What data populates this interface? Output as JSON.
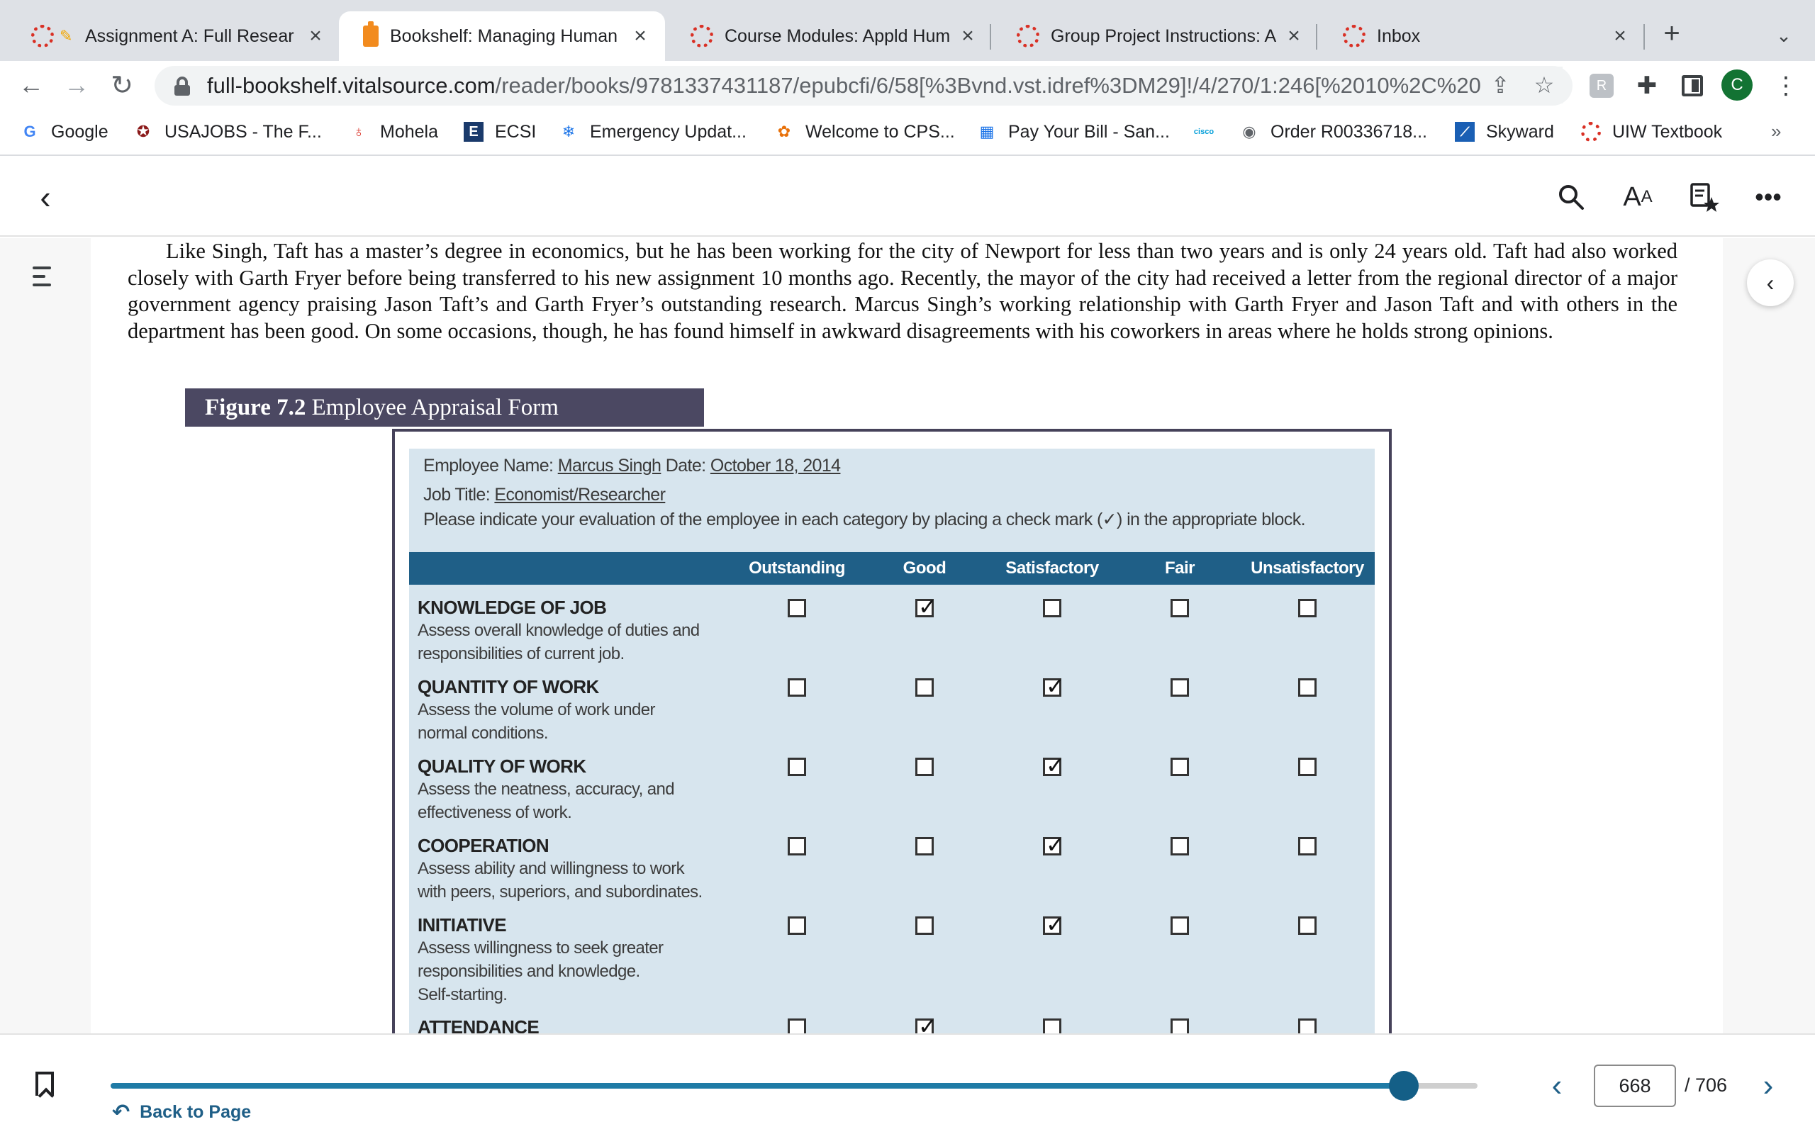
{
  "browser": {
    "tabs": [
      {
        "title": "Assignment A: Full Resear",
        "active": false
      },
      {
        "title": "Bookshelf: Managing Human",
        "active": true
      },
      {
        "title": "Course Modules: Appld Huma",
        "active": false
      },
      {
        "title": "Group Project Instructions: A",
        "active": false
      },
      {
        "title": "Inbox",
        "active": false
      }
    ],
    "url_host": "full-bookshelf.vitalsource.com",
    "url_path": "/reader/books/9781337431187/epubcfi/6/58[%3Bvnd.vst.idref%3DM29]!/4/270/1:246[%2010%2C%20...",
    "profile_initial": "C",
    "bookmarks": [
      {
        "label": "Google",
        "icon": "google-icon"
      },
      {
        "label": "USAJOBS - The F...",
        "icon": "usajobs-icon"
      },
      {
        "label": "Mohela",
        "icon": "apple-icon"
      },
      {
        "label": "ECSI",
        "icon": "ecsi-icon"
      },
      {
        "label": "Emergency Updat...",
        "icon": "snowflake-icon"
      },
      {
        "label": "Welcome to CPS...",
        "icon": "flower-icon"
      },
      {
        "label": "Pay Your Bill - San...",
        "icon": "bill-icon"
      },
      {
        "label": "",
        "icon": "cisco-icon"
      },
      {
        "label": "Order R00336718...",
        "icon": "order-icon"
      },
      {
        "label": "Skyward",
        "icon": "skyward-icon"
      },
      {
        "label": "UIW Textbook",
        "icon": "uiw-icon"
      }
    ],
    "cisco_text": "cisco",
    "more_bookmarks": "»"
  },
  "reader": {
    "paragraph": "Like Singh, Taft has a master’s degree in economics, but he has been working for the city of Newport for less than two years and is only 24 years old. Taft had also worked closely with Garth Fryer before being transferred to his new assignment 10 months ago. Recently, the mayor of the city had received a letter from the regional director of a major government agency praising Jason Taft’s and Garth Fryer’s outstanding research. Marcus Singh’s working relationship with Garth Fryer and Jason Taft and with others in the department has been good. On some occasions, though, he has found himself in awkward disagreements with his coworkers in areas where he holds strong opinions.",
    "figure": {
      "number": "Figure 7.2",
      "title": "Employee Appraisal Form"
    },
    "form": {
      "employee_name_label": "Employee Name:",
      "employee_name": "Marcus Singh",
      "date_label": "Date:",
      "date": "October 18, 2014",
      "job_title_label": "Job Title:",
      "job_title": "Economist/Researcher",
      "instructions": "Please indicate your evaluation of the employee in each category by placing a check mark (✓) in the appropriate block.",
      "ratings": [
        "Outstanding",
        "Good",
        "Satisfactory",
        "Fair",
        "Unsatisfactory"
      ],
      "criteria": [
        {
          "title": "KNOWLEDGE OF JOB",
          "desc": [
            "Assess overall knowledge of duties and",
            "responsibilities of current job."
          ],
          "checked": 1
        },
        {
          "title": "QUANTITY OF WORK",
          "desc": [
            "Assess the volume of work under",
            "normal conditions."
          ],
          "checked": 2
        },
        {
          "title": "QUALITY OF WORK",
          "desc": [
            "Assess the neatness, accuracy, and",
            "effectiveness of work."
          ],
          "checked": 2
        },
        {
          "title": "COOPERATION",
          "desc": [
            "Assess ability and willingness to work",
            "with peers, superiors, and subordinates."
          ],
          "checked": 2
        },
        {
          "title": "INITIATIVE",
          "desc": [
            "Assess willingness to seek greater",
            "responsibilities and knowledge.",
            "Self-starting."
          ],
          "checked": 2
        },
        {
          "title": "ATTENDANCE",
          "desc": [],
          "checked": 1
        }
      ]
    },
    "footer": {
      "back_to_page": "Back to Page",
      "current_page": "668",
      "total_pages": "/ 706",
      "progress": 0.9461
    }
  }
}
